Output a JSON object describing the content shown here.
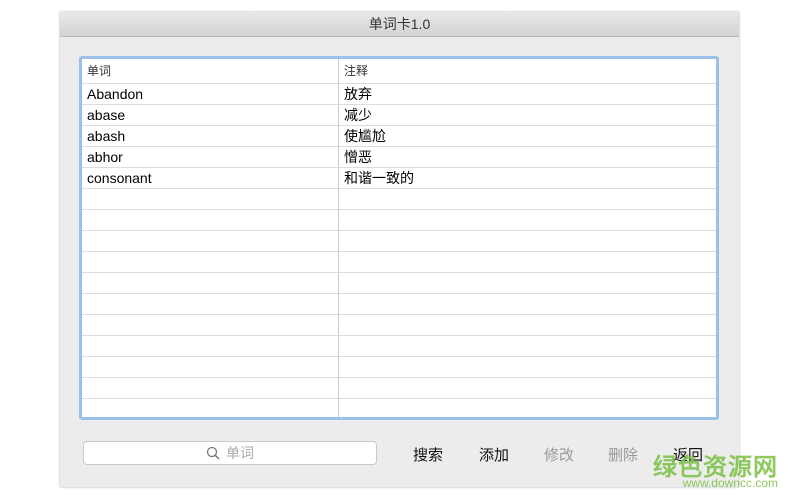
{
  "window": {
    "title": "单词卡1.0"
  },
  "table": {
    "headers": [
      "单词",
      "注释"
    ],
    "rows": [
      [
        "Abandon",
        "放弃"
      ],
      [
        "abase",
        "减少"
      ],
      [
        "abash",
        "使尴尬"
      ],
      [
        "abhor",
        "憎恶"
      ],
      [
        "consonant",
        "和谐一致的"
      ],
      [
        "",
        ""
      ],
      [
        "",
        ""
      ],
      [
        "",
        ""
      ],
      [
        "",
        ""
      ],
      [
        "",
        ""
      ],
      [
        "",
        ""
      ],
      [
        "",
        ""
      ],
      [
        "",
        ""
      ],
      [
        "",
        ""
      ],
      [
        "",
        ""
      ],
      [
        "",
        ""
      ]
    ]
  },
  "search": {
    "placeholder": "单词"
  },
  "buttons": {
    "search": "搜索",
    "add": "添加",
    "edit": "修改",
    "delete": "删除",
    "back": "返回"
  },
  "watermark": {
    "name": "绿色资源网",
    "url": "www.downcc.com"
  }
}
